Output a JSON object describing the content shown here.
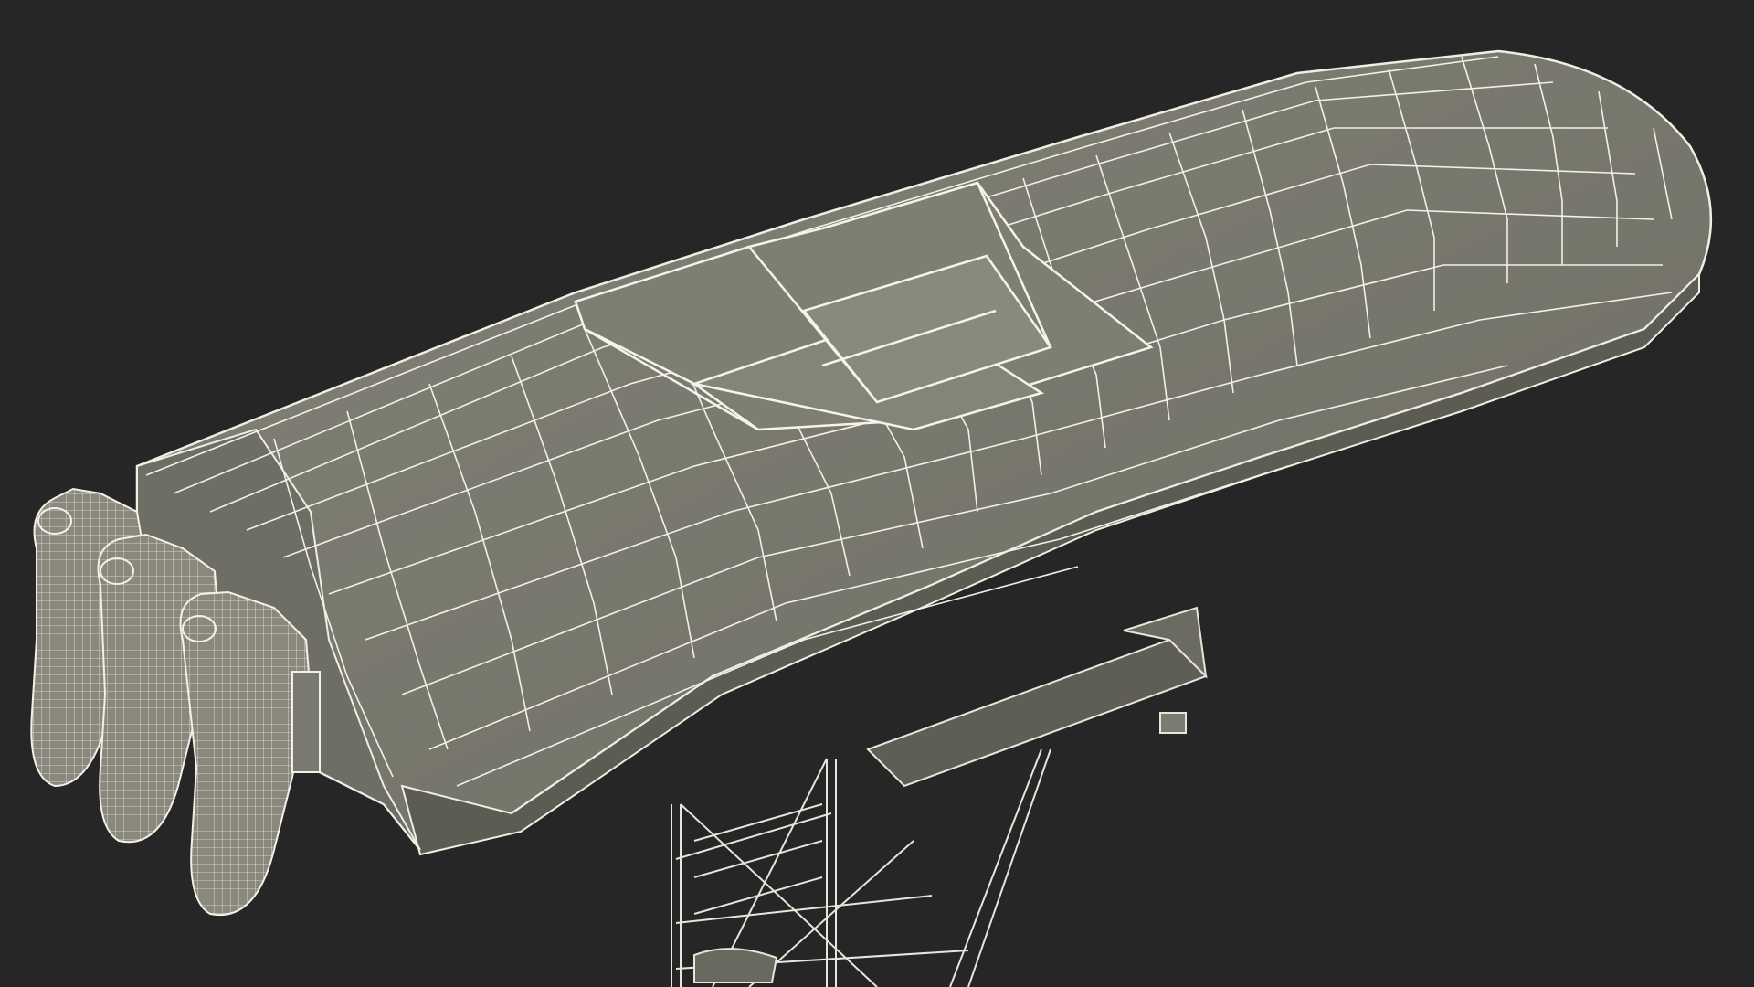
{
  "viewport": {
    "background_color": "#262626",
    "model_fill_color": "#7b7a6f",
    "model_shadow_color": "#5c5b52",
    "wire_color": "#f1f0e6",
    "content": "wireframe-render-of-boat-hull-with-three-outboard-motors-on-stand"
  }
}
